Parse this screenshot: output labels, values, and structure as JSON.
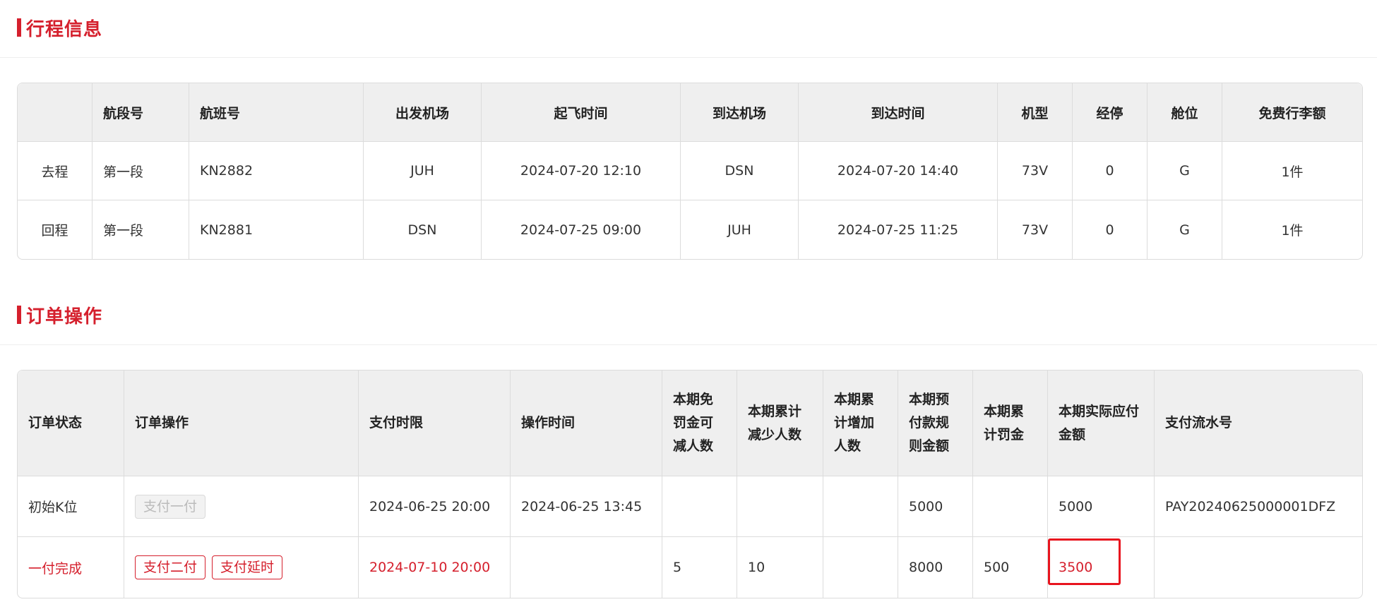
{
  "trip_section": {
    "title": "行程信息"
  },
  "trip_table": {
    "headers": [
      "",
      "航段号",
      "航班号",
      "出发机场",
      "起飞时间",
      "到达机场",
      "到达时间",
      "机型",
      "经停",
      "舱位",
      "免费行李额"
    ],
    "rows": [
      [
        "去程",
        "第一段",
        "KN2882",
        "JUH",
        "2024-07-20 12:10",
        "DSN",
        "2024-07-20 14:40",
        "73V",
        "0",
        "G",
        "1件"
      ],
      [
        "回程",
        "第一段",
        "KN2881",
        "DSN",
        "2024-07-25 09:00",
        "JUH",
        "2024-07-25 11:25",
        "73V",
        "0",
        "G",
        "1件"
      ]
    ]
  },
  "order_section": {
    "title": "订单操作"
  },
  "order_table": {
    "headers": [
      "订单状态",
      "订单操作",
      "支付时限",
      "操作时间",
      "本期免罚金可减人数",
      "本期累计减少人数",
      "本期累计增加人数",
      "本期预付款规则金额",
      "本期累计罚金",
      "本期实际应付金额",
      "支付流水号"
    ],
    "rows": [
      {
        "status": "初始K位",
        "actions": [
          "支付一付"
        ],
        "pay_deadline": "2024-06-25 20:00",
        "op_time": "2024-06-25 13:45",
        "waive_count": "",
        "reduced": "",
        "increased": "",
        "prepay_amount": "5000",
        "penalty": "",
        "actual_amount": "5000",
        "serial": "PAY20240625000001DFZ"
      },
      {
        "status": "一付完成",
        "actions": [
          "支付二付",
          "支付延时"
        ],
        "pay_deadline": "2024-07-10 20:00",
        "op_time": "",
        "waive_count": "5",
        "reduced": "10",
        "increased": "",
        "prepay_amount": "8000",
        "penalty": "500",
        "actual_amount": "3500",
        "serial": ""
      }
    ]
  },
  "colors": {
    "accent": "#d5202d",
    "header_bg": "#efefef",
    "border": "#dcdcdc",
    "highlight": "#e8141e"
  }
}
